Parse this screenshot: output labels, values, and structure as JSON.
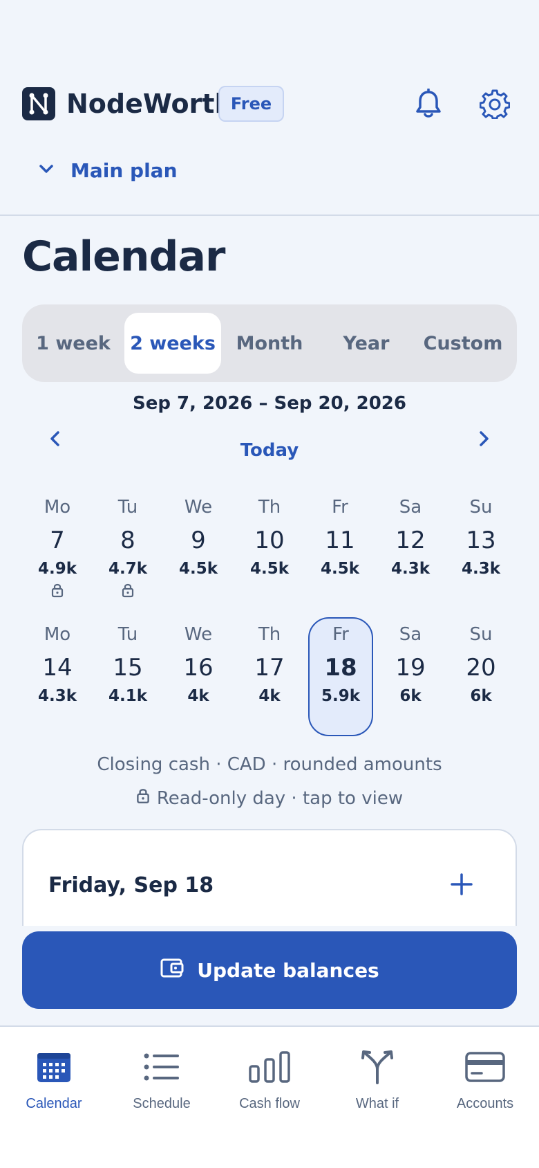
{
  "header": {
    "app_name": "NodeWorth",
    "plan_badge": "Free",
    "plan_selector": "Main plan"
  },
  "page": {
    "title": "Calendar"
  },
  "range_tabs": {
    "items": [
      "1 week",
      "2 weeks",
      "Month",
      "Year",
      "Custom"
    ],
    "selected": "2 weeks"
  },
  "date_range": "Sep 7, 2026 – Sep 20, 2026",
  "today_label": "Today",
  "week1": [
    {
      "dow": "Mo",
      "day": "7",
      "value": "4.9k",
      "locked": true
    },
    {
      "dow": "Tu",
      "day": "8",
      "value": "4.7k",
      "locked": true
    },
    {
      "dow": "We",
      "day": "9",
      "value": "4.5k",
      "locked": false
    },
    {
      "dow": "Th",
      "day": "10",
      "value": "4.5k",
      "locked": false
    },
    {
      "dow": "Fr",
      "day": "11",
      "value": "4.5k",
      "locked": false
    },
    {
      "dow": "Sa",
      "day": "12",
      "value": "4.3k",
      "locked": false
    },
    {
      "dow": "Su",
      "day": "13",
      "value": "4.3k",
      "locked": false
    }
  ],
  "week2": [
    {
      "dow": "Mo",
      "day": "14",
      "value": "4.3k",
      "locked": false
    },
    {
      "dow": "Tu",
      "day": "15",
      "value": "4.1k",
      "locked": false
    },
    {
      "dow": "We",
      "day": "16",
      "value": "4k",
      "locked": false
    },
    {
      "dow": "Th",
      "day": "17",
      "value": "4k",
      "locked": false
    },
    {
      "dow": "Fr",
      "day": "18",
      "value": "5.9k",
      "locked": false,
      "selected": true
    },
    {
      "dow": "Sa",
      "day": "19",
      "value": "6k",
      "locked": false
    },
    {
      "dow": "Su",
      "day": "20",
      "value": "6k",
      "locked": false
    }
  ],
  "legend": {
    "line1": "Closing cash · CAD · rounded amounts",
    "line2": "Read-only day · tap to view"
  },
  "detail_card": {
    "title": "Friday, Sep 18"
  },
  "update_button": "Update balances",
  "tabbar": {
    "items": [
      {
        "label": "Calendar",
        "icon": "calendar-icon",
        "active": true
      },
      {
        "label": "Schedule",
        "icon": "list-icon",
        "active": false
      },
      {
        "label": "Cash flow",
        "icon": "bar-chart-icon",
        "active": false
      },
      {
        "label": "What if",
        "icon": "split-icon",
        "active": false
      },
      {
        "label": "Accounts",
        "icon": "card-icon",
        "active": false
      }
    ]
  },
  "colors": {
    "accent": "#2a57b8",
    "text": "#1b2a45",
    "muted": "#58677f",
    "background": "#f1f5fb"
  }
}
